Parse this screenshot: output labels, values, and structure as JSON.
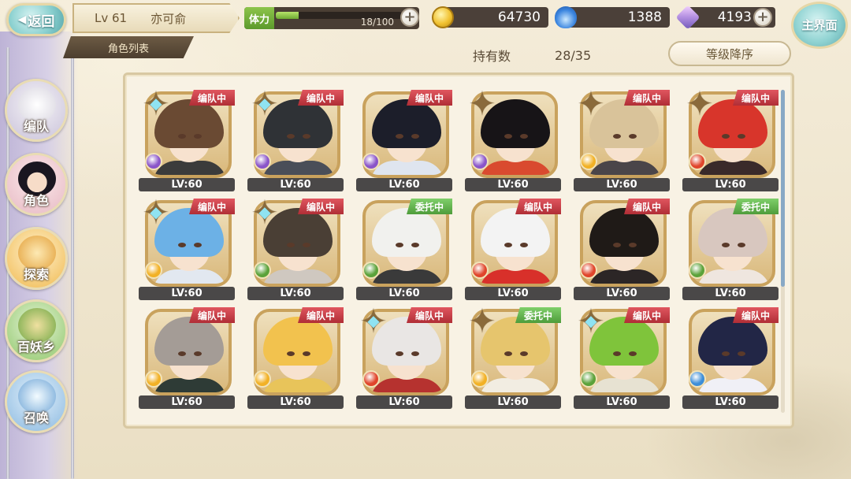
{
  "header": {
    "back_label": "返回",
    "level": "Lv 61",
    "player_name": "亦可俞",
    "sub_title": "角色列表",
    "stamina_label": "体力",
    "stamina_value": "18/100",
    "stamina_fraction": 0.18,
    "gold": "64730",
    "soul_fire": "1388",
    "gems": "4193",
    "plus_symbol": "+",
    "home_label": "主界面"
  },
  "summary": {
    "owned_label": "持有数",
    "owned_value": "28/35",
    "sort_label": "等级降序"
  },
  "side_menu": [
    {
      "label": "编队",
      "icon": "formation-icon"
    },
    {
      "label": "角色",
      "icon": "character-icon"
    },
    {
      "label": "探索",
      "icon": "explore-icon"
    },
    {
      "label": "百妖乡",
      "icon": "village-icon"
    },
    {
      "label": "召唤",
      "icon": "summon-icon"
    }
  ],
  "status_labels": {
    "formation": "编队中",
    "commission": "委托中"
  },
  "characters": [
    {
      "level": "LV:60",
      "status": "编队中",
      "status_type": "formation",
      "star": "cyan",
      "attr": "purple",
      "hair": "#6a4a33",
      "outfit": "#3b3b3b"
    },
    {
      "level": "LV:60",
      "status": "编队中",
      "status_type": "formation",
      "star": "cyan",
      "attr": "purple",
      "hair": "#2f3236",
      "outfit": "#4a4e58"
    },
    {
      "level": "LV:60",
      "status": "编队中",
      "status_type": "formation",
      "star": "none",
      "attr": "purple",
      "hair": "#1c1e2a",
      "outfit": "#dfe5ef"
    },
    {
      "level": "LV:60",
      "status": "",
      "status_type": "none",
      "star": "plain",
      "attr": "purple",
      "hair": "#171417",
      "outfit": "#d94a2f"
    },
    {
      "level": "LV:60",
      "status": "编队中",
      "status_type": "formation",
      "star": "plain",
      "attr": "gold",
      "hair": "#d9c39a",
      "outfit": "#4a4549"
    },
    {
      "level": "LV:60",
      "status": "编队中",
      "status_type": "formation",
      "star": "plain",
      "attr": "red",
      "hair": "#d8352b",
      "outfit": "#3a2a2a"
    },
    {
      "level": "LV:60",
      "status": "编队中",
      "status_type": "formation",
      "star": "cyan",
      "attr": "gold",
      "hair": "#6cb1e6",
      "outfit": "#e2e8f0"
    },
    {
      "level": "LV:60",
      "status": "编队中",
      "status_type": "formation",
      "star": "cyan",
      "attr": "green",
      "hair": "#4a3f35",
      "outfit": "#cfc8c0"
    },
    {
      "level": "LV:60",
      "status": "委托中",
      "status_type": "commission",
      "star": "none",
      "attr": "green",
      "hair": "#f1f1ee",
      "outfit": "#3a3a3a"
    },
    {
      "level": "LV:60",
      "status": "编队中",
      "status_type": "formation",
      "star": "none",
      "attr": "red",
      "hair": "#f3f3f3",
      "outfit": "#d8302a"
    },
    {
      "level": "LV:60",
      "status": "编队中",
      "status_type": "formation",
      "star": "none",
      "attr": "red",
      "hair": "#1f1a17",
      "outfit": "#2c2626"
    },
    {
      "level": "LV:60",
      "status": "委托中",
      "status_type": "commission",
      "star": "none",
      "attr": "green",
      "hair": "#d8c7bf",
      "outfit": "#efe6df"
    },
    {
      "level": "LV:60",
      "status": "编队中",
      "status_type": "formation",
      "star": "none",
      "attr": "gold",
      "hair": "#a49c96",
      "outfit": "#2e3b36"
    },
    {
      "level": "LV:60",
      "status": "编队中",
      "status_type": "formation",
      "star": "none",
      "attr": "gold",
      "hair": "#f2c24e",
      "outfit": "#e8c45a"
    },
    {
      "level": "LV:60",
      "status": "编队中",
      "status_type": "formation",
      "star": "cyan",
      "attr": "red",
      "hair": "#e9e6e4",
      "outfit": "#b6322f"
    },
    {
      "level": "LV:60",
      "status": "委托中",
      "status_type": "commission",
      "star": "plain",
      "attr": "gold",
      "hair": "#e6c56d",
      "outfit": "#f2ede2"
    },
    {
      "level": "LV:60",
      "status": "编队中",
      "status_type": "formation",
      "star": "cyan",
      "attr": "green",
      "hair": "#7fc43b",
      "outfit": "#e7e2d2"
    },
    {
      "level": "LV:60",
      "status": "编队中",
      "status_type": "formation",
      "star": "none",
      "attr": "blue",
      "hair": "#222646",
      "outfit": "#f0f0f6"
    }
  ],
  "colors": {
    "attr_purple": "#8a55c9",
    "attr_gold": "#f2b125",
    "attr_red": "#e0452b",
    "attr_green": "#5ba23a",
    "attr_blue": "#3d8ed8"
  }
}
